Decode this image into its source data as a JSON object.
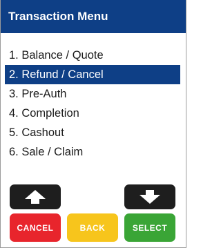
{
  "title": "Transaction Menu",
  "menu": {
    "items": [
      {
        "label": "1. Balance / Quote"
      },
      {
        "label": "2. Refund / Cancel"
      },
      {
        "label": "3. Pre-Auth"
      },
      {
        "label": "4. Completion"
      },
      {
        "label": "5. Cashout"
      },
      {
        "label": "6. Sale / Claim"
      }
    ],
    "selected_index": 1
  },
  "keys": {
    "up_icon": "arrow-up-icon",
    "down_icon": "arrow-down-icon",
    "cancel_label": "CANCEL",
    "back_label": "BACK",
    "select_label": "SELECT"
  },
  "colors": {
    "header": "#0e3f86",
    "selection": "#0e3f86",
    "cancel": "#e8252c",
    "back": "#f7c51c",
    "select": "#3aa536",
    "arrow_key": "#1e1e1e"
  }
}
